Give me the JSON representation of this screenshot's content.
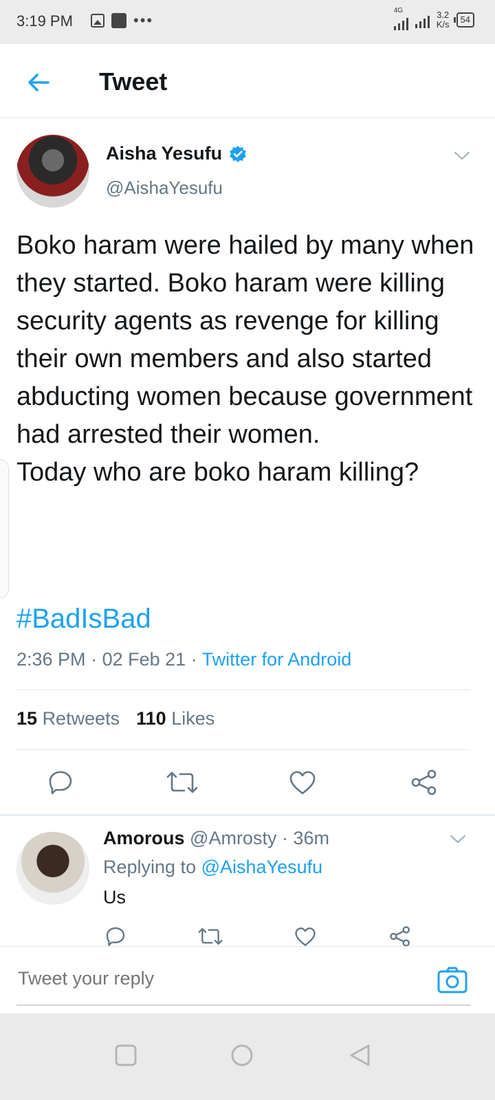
{
  "status_bar": {
    "time": "3:19 PM",
    "network": "4G",
    "speed_value": "3.2",
    "speed_unit": "K/s",
    "battery": "54"
  },
  "header": {
    "title": "Tweet"
  },
  "tweet": {
    "author_name": "Aisha Yesufu",
    "author_handle": "@AishaYesufu",
    "verified": true,
    "text": "Boko haram were hailed by many when they started. Boko haram were killing security agents as revenge for killing their own members and also started abducting women because government had arrested their women.\nToday who are boko haram killing?",
    "hashtag": "#BadIsBad",
    "time": "2:36 PM",
    "date": "02 Feb 21",
    "source": "Twitter for Android",
    "retweets_count": "15",
    "retweets_label": "Retweets",
    "likes_count": "110",
    "likes_label": "Likes"
  },
  "reply": {
    "name": "Amorous",
    "handle": "@Amrosty",
    "time": "36m",
    "replying_to_label": "Replying to",
    "replying_to_handle": "@AishaYesufu",
    "text": "Us"
  },
  "compose": {
    "placeholder": "Tweet your reply"
  },
  "colors": {
    "accent": "#1da1f2",
    "secondary_text": "#657786",
    "primary_text": "#14171a"
  }
}
